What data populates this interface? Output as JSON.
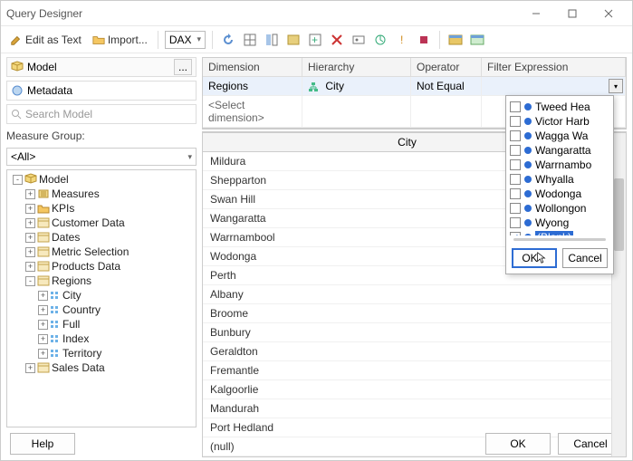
{
  "window": {
    "title": "Query Designer"
  },
  "toolbar": {
    "edit_as_text": "Edit as Text",
    "import": "Import...",
    "lang": "DAX"
  },
  "left": {
    "model_label": "Model",
    "metadata_label": "Metadata",
    "search_placeholder": "Search Model",
    "measure_group_label": "Measure Group:",
    "measure_group_value": "<All>",
    "tree": [
      {
        "depth": 0,
        "exp": "-",
        "icon": "cube",
        "label": "Model"
      },
      {
        "depth": 1,
        "exp": "+",
        "icon": "meas",
        "label": "Measures"
      },
      {
        "depth": 1,
        "exp": "+",
        "icon": "folder",
        "label": "KPIs"
      },
      {
        "depth": 1,
        "exp": "+",
        "icon": "table",
        "label": "Customer Data"
      },
      {
        "depth": 1,
        "exp": "+",
        "icon": "table",
        "label": "Dates"
      },
      {
        "depth": 1,
        "exp": "+",
        "icon": "table",
        "label": "Metric Selection"
      },
      {
        "depth": 1,
        "exp": "+",
        "icon": "table",
        "label": "Products Data"
      },
      {
        "depth": 1,
        "exp": "-",
        "icon": "table",
        "label": "Regions"
      },
      {
        "depth": 2,
        "exp": "+",
        "icon": "field",
        "label": "City"
      },
      {
        "depth": 2,
        "exp": "+",
        "icon": "field",
        "label": "Country"
      },
      {
        "depth": 2,
        "exp": "+",
        "icon": "field",
        "label": "Full"
      },
      {
        "depth": 2,
        "exp": "+",
        "icon": "field",
        "label": "Index"
      },
      {
        "depth": 2,
        "exp": "+",
        "icon": "field",
        "label": "Territory"
      },
      {
        "depth": 1,
        "exp": "+",
        "icon": "table",
        "label": "Sales Data"
      }
    ]
  },
  "filter": {
    "headers": {
      "dim": "Dimension",
      "hier": "Hierarchy",
      "op": "Operator",
      "fe": "Filter Expression"
    },
    "row": {
      "dim": "Regions",
      "hier": "City",
      "op": "Not Equal"
    },
    "select_dim": "<Select dimension>"
  },
  "grid": {
    "header": "City",
    "rows": [
      "Mildura",
      "Shepparton",
      "Swan Hill",
      "Wangaratta",
      "Warrnambool",
      "Wodonga",
      "Perth",
      "Albany",
      "Broome",
      "Bunbury",
      "Geraldton",
      "Fremantle",
      "Kalgoorlie",
      "Mandurah",
      "Port Hedland",
      "(null)"
    ]
  },
  "popup": {
    "items": [
      {
        "label": "Tweed Hea",
        "checked": false
      },
      {
        "label": "Victor Harb",
        "checked": false
      },
      {
        "label": "Wagga Wa",
        "checked": false
      },
      {
        "label": "Wangaratta",
        "checked": false
      },
      {
        "label": "Warrnambo",
        "checked": false
      },
      {
        "label": "Whyalla",
        "checked": false
      },
      {
        "label": "Wodonga",
        "checked": false
      },
      {
        "label": "Wollongon",
        "checked": false
      },
      {
        "label": "Wyong",
        "checked": false
      },
      {
        "label": "(Blank)",
        "checked": true,
        "selected": true
      }
    ],
    "ok": "OK",
    "cancel": "Cancel"
  },
  "footer": {
    "help": "Help",
    "ok": "OK",
    "cancel": "Cancel"
  }
}
